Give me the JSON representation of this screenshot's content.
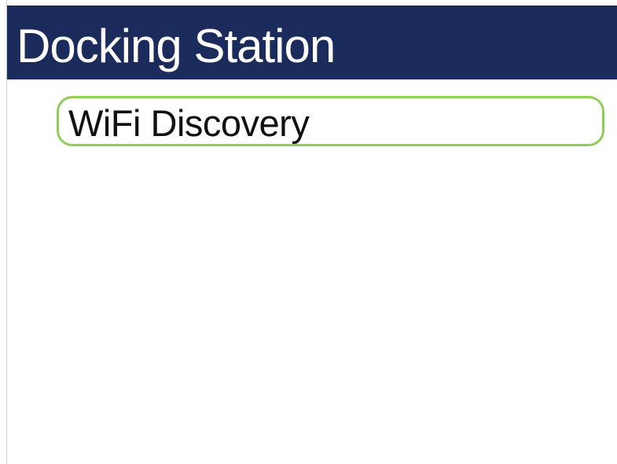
{
  "header": {
    "title": "Docking Station"
  },
  "menu": {
    "items": [
      {
        "label": "WiFi Discovery",
        "selected": true
      }
    ]
  },
  "colors": {
    "header_background": "#1b2b5c",
    "header_text": "#ffffff",
    "selection_border": "#8fce5a",
    "item_text": "#111111"
  }
}
